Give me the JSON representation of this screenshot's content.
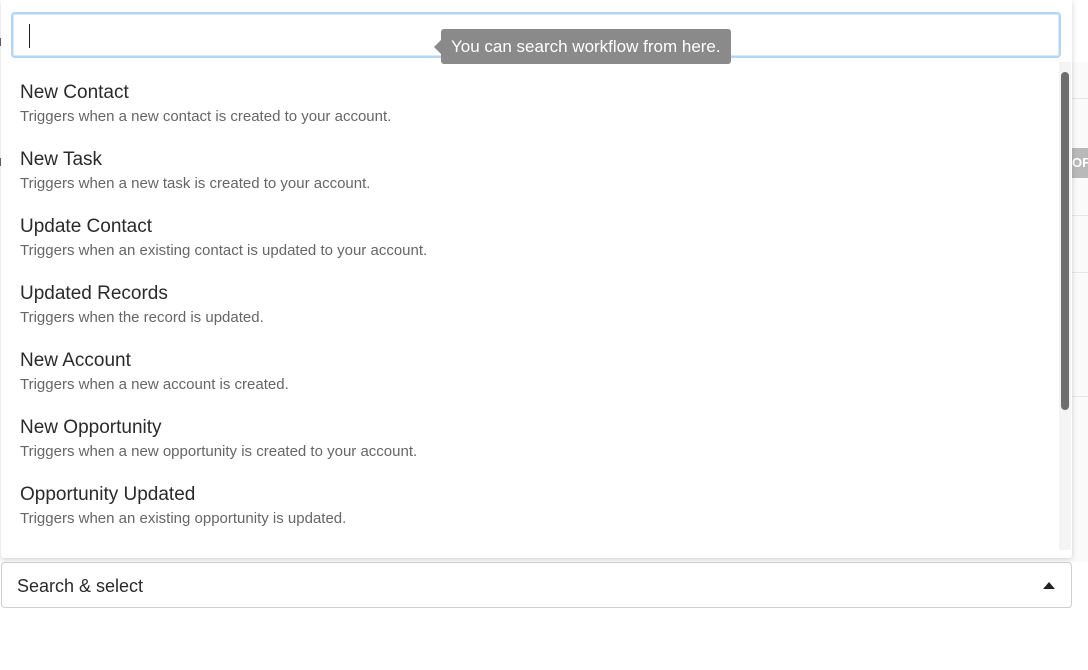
{
  "search": {
    "value": "",
    "placeholder": "",
    "tooltip": "You can search workflow from here."
  },
  "triggers": [
    {
      "title": "New Contact",
      "description": "Triggers when a new contact is created to your account."
    },
    {
      "title": "New Task",
      "description": "Triggers when a new task is created to your account."
    },
    {
      "title": "Update Contact",
      "description": "Triggers when an existing contact is updated to your account."
    },
    {
      "title": "Updated Records",
      "description": "Triggers when the record is updated."
    },
    {
      "title": "New Account",
      "description": "Triggers when a new account is created."
    },
    {
      "title": "New Opportunity",
      "description": "Triggers when a new opportunity is created to your account."
    },
    {
      "title": "Opportunity Updated",
      "description": "Triggers when an existing opportunity is updated."
    }
  ],
  "select": {
    "label": "Search & select"
  },
  "background": {
    "badge_text": "OF"
  },
  "colors": {
    "focus_border": "#b3d4f5",
    "tooltip_bg": "#8a8a8a",
    "scroll_thumb": "#6e6e6e"
  }
}
